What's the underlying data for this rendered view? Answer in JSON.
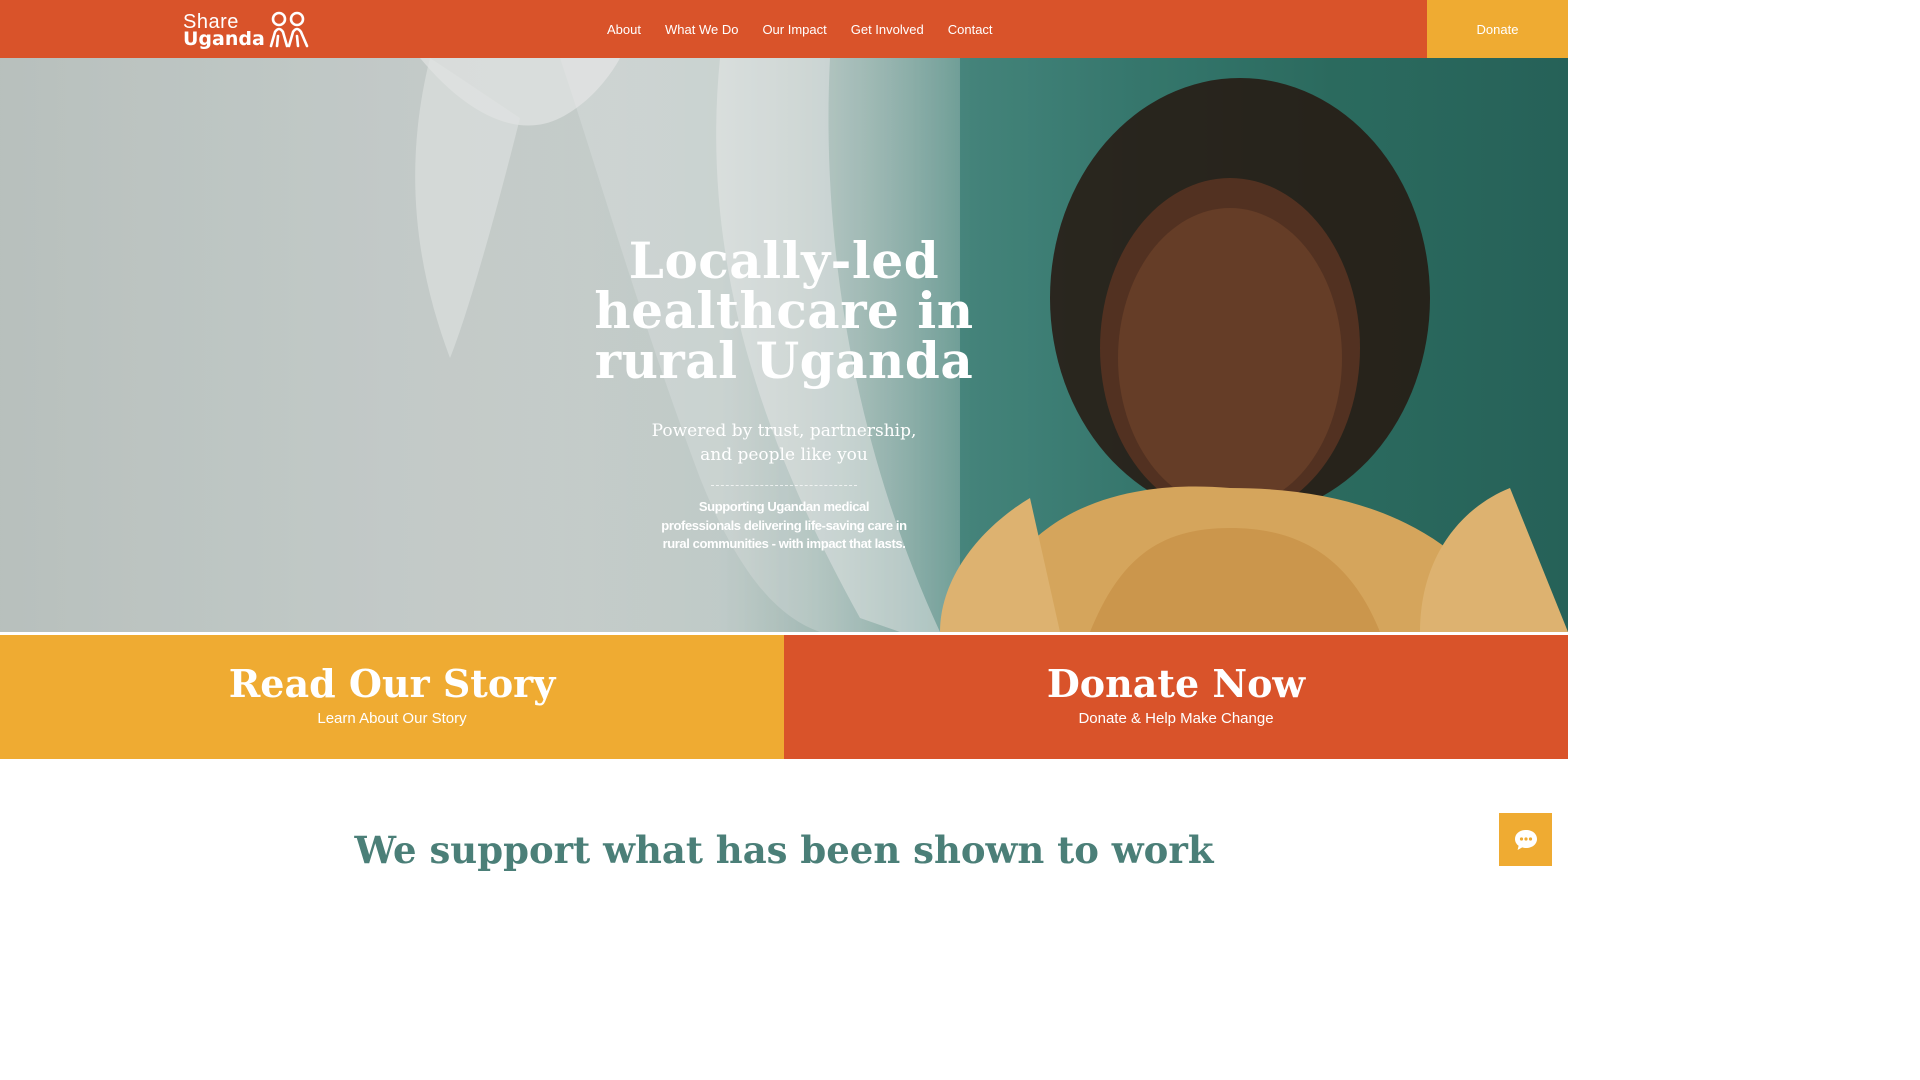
{
  "header": {
    "logo": {
      "line1": "Share",
      "line2": "Uganda"
    },
    "nav": [
      "About",
      "What We Do",
      "Our Impact",
      "Get Involved",
      "Contact"
    ],
    "donate_label": "Donate"
  },
  "hero": {
    "title_lines": [
      "Locally-led",
      "healthcare in",
      "rural Uganda"
    ],
    "subtitle_lines": [
      "Powered by trust, partnership,",
      "and people like you"
    ],
    "description": "Supporting Ugandan medical professionals delivering life-saving care in rural communities - with impact that lasts."
  },
  "cta": {
    "left": {
      "title": "Read Our Story",
      "subtitle": "Learn About Our Story"
    },
    "right": {
      "title": "Donate Now",
      "subtitle": "Donate &  Help Make Change"
    }
  },
  "section": {
    "heading": "We support what has been shown to work"
  },
  "colors": {
    "primary_orange": "#d9532a",
    "accent_yellow": "#efab32",
    "heading_teal": "#4b7f78"
  },
  "icons": {
    "chat": "chat-bubble-icon",
    "logo": "people-figures-icon"
  }
}
